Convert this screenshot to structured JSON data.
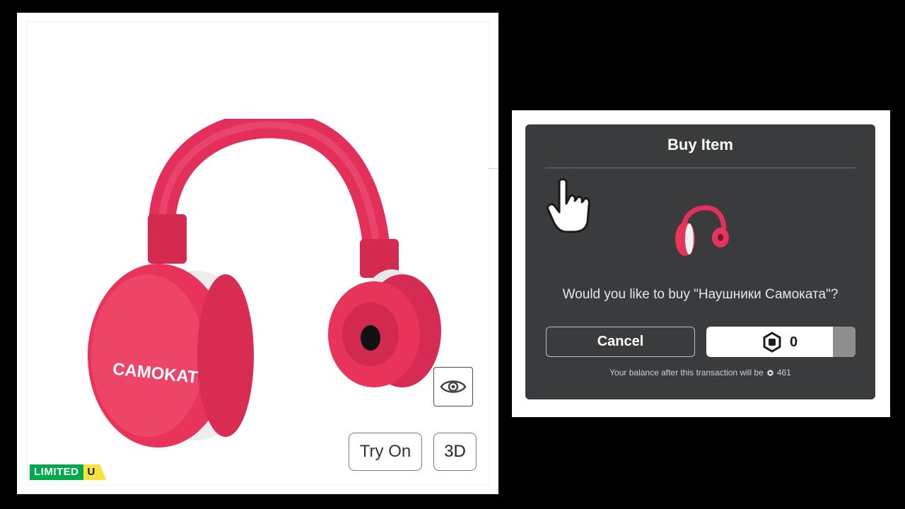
{
  "item_preview": {
    "limited_label": "LIMITED",
    "limited_u_label": "U",
    "try_on_label": "Try On",
    "three_d_label": "3D",
    "headphone_brand_text": "CAMOKAT"
  },
  "buy_modal": {
    "title": "Buy Item",
    "question": "Would you like to buy \"Наушники Самоката\"?",
    "cancel_label": "Cancel",
    "price": "0",
    "balance_prefix": "Your balance after this transaction will be",
    "balance_value": "461"
  },
  "icons": {
    "eye": "eye-icon",
    "robux": "robux-icon",
    "cursor": "hand-cursor-icon"
  },
  "colors": {
    "headphone_red": "#e8335a",
    "modal_bg": "#393b3d",
    "limited_green": "#00a84f",
    "limited_yellow": "#f9e23a"
  }
}
